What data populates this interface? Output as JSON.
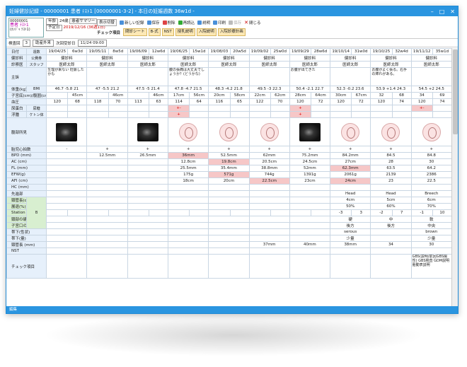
{
  "window": {
    "title": "妊婦健診記録 - 00000001 患者 ﾃｽﾄ1 [00000001-3-2] - 本日の妊娠週数 36w1d -",
    "controls": [
      "–",
      "□",
      "✕"
    ]
  },
  "patient": {
    "id": "00000001",
    "name": "患者 ﾃｽﾄ1",
    "kana": "(ｶﾝｼﾞｬ ﾃｽﾄ1)",
    "age_label": "年齢",
    "age": "24歳",
    "summary_button": "患者サマリー",
    "due_label": "予定日",
    "due_date": "2019/12/16 (36週1日)"
  },
  "toolbar": {
    "row1": [
      {
        "label": "表示切替"
      },
      {
        "label": "新しい記録"
      },
      {
        "label": "保存"
      },
      {
        "label": "削除"
      },
      {
        "label": "再読込"
      },
      {
        "label": "説明"
      },
      {
        "label": "印刷"
      },
      {
        "label": "保存"
      },
      {
        "label": "閉じる"
      }
    ],
    "row2_title": "チェック項目",
    "row2": [
      "問診シート",
      "B-式",
      "NST",
      "授乳説明",
      "入院説明",
      "入院診療計画"
    ]
  },
  "filter": {
    "exam_count_label": "検査回",
    "exam_count": "3",
    "type": "助産外来",
    "next_label": "次回受診日",
    "next_date": "11/24 09:00"
  },
  "columns": [
    {
      "date": "19/04/25",
      "week": "6w3d"
    },
    {
      "date": "19/05/11",
      "week": "8w5d"
    },
    {
      "date": "19/06/09",
      "week": "12w6d"
    },
    {
      "date": "19/06/25",
      "week": "15w1d"
    },
    {
      "date": "19/08/03",
      "week": "20w5d"
    },
    {
      "date": "19/09/02",
      "week": "25w0d"
    },
    {
      "date": "19/09/29",
      "week": "28w6d"
    },
    {
      "date": "19/10/14",
      "week": "31w0d"
    },
    {
      "date": "19/10/25",
      "week": "32w4d"
    },
    {
      "date": "19/11/12",
      "week": "35w1d"
    }
  ],
  "labels": {
    "date": "日付",
    "week": "週数",
    "consent": "健診料",
    "insurance": "公費券",
    "doctor": "診察医",
    "staff": "スタッフ",
    "complaint": "主訴",
    "weight": "体重(kg)",
    "bmi": "BMI",
    "fundus": "子宮底(cm)/腹囲(cm)",
    "bp": "血圧",
    "urine_protein": "尿蛋白",
    "urine_sugar": "尿糖",
    "edema": "浮腫",
    "ketone": "ケトン体",
    "echo": "腹部所見",
    "fhb": "胎児心拍数",
    "bpd": "BPD (mm)",
    "ac": "AC (cm)",
    "fl": "FL (mm)",
    "efw": "EFW(g)",
    "afi": "AFI (cm)",
    "hc": "HC (mm)",
    "presentation": "先進部",
    "cervix_len": "頸管長(cm)",
    "effacement": "展退(%)",
    "station": "Station",
    "cervix_hard": "頸部の硬さ",
    "cervix_pos": "子宮口の位置",
    "bishop": "B",
    "discharge": "帯下(性状)",
    "discharge_amt": "帯下(量)",
    "cervical_len2": "頸管長 (mm)",
    "nst": "NST",
    "check": "チェック項目"
  },
  "rows": {
    "consent": [
      "健診料",
      "健診料",
      "健診料",
      "健診料",
      "健診料",
      "健診料",
      "健診料",
      "健診料",
      "健診料",
      "健診料"
    ],
    "doctor": [
      "医師太郎",
      "医師太郎",
      "医師太郎",
      "医師太郎",
      "医師太郎",
      "医師太郎",
      "医師太郎",
      "医師太郎",
      "医師太郎",
      "医師太郎"
    ],
    "complaint": [
      "生理が来ない 妊娠したかも",
      "",
      "",
      "腹の張痛は大丈夫でしょうか？(どうかな)",
      "",
      "",
      "お腹が出てきた",
      "",
      "お腹がよく張る。右手の痺れがある。",
      ""
    ],
    "weight": [
      [
        "46.7",
        "-5.8",
        "21"
      ],
      [
        "47",
        "-5.5",
        "21.2"
      ],
      [
        "47.5",
        "-5",
        "21.4"
      ],
      [
        "47.8",
        "-4.7",
        "21.5"
      ],
      [
        "48.3",
        "-4.2",
        "21.8"
      ],
      [
        "49.5",
        "-3",
        "22.3"
      ],
      [
        "50.4",
        "-2.1",
        "22.7"
      ],
      [
        "52.3",
        "-0.2",
        "23.6"
      ],
      [
        "53.9",
        "+1.4",
        "24.3"
      ],
      [
        "54.5",
        "+2",
        "24.5"
      ]
    ],
    "fundus": [
      [
        "",
        "45cm"
      ],
      [
        "",
        "46cm"
      ],
      [
        "",
        "46cm"
      ],
      [
        "17cm",
        "56cm"
      ],
      [
        "20cm",
        "58cm"
      ],
      [
        "22cm",
        "62cm"
      ],
      [
        "28cm",
        "64cm"
      ],
      [
        "30cm",
        "67cm"
      ],
      [
        "32",
        "68"
      ],
      [
        "34",
        "69"
      ]
    ],
    "bp": [
      [
        "120",
        "68"
      ],
      [
        "118",
        "70"
      ],
      [
        "113",
        "63"
      ],
      [
        "114",
        "64"
      ],
      [
        "116",
        "65"
      ],
      [
        "122",
        "70"
      ],
      [
        "120",
        "72"
      ],
      [
        "120",
        "72"
      ],
      [
        "120",
        "74"
      ],
      [
        "120",
        "74"
      ]
    ],
    "urine_protein": [
      "",
      "",
      "",
      "+-",
      "",
      "",
      "+",
      "",
      "",
      "+-"
    ],
    "edema": [
      "",
      "",
      "",
      "+",
      "",
      "",
      "+",
      "",
      "",
      ""
    ],
    "echo": [
      "us",
      "",
      "us",
      "fetal",
      "fetal",
      "fetal",
      "us",
      "fetal",
      "fetal",
      "fetal"
    ],
    "fhb": [
      "-",
      "+",
      "+",
      "+",
      "+",
      "+",
      "+",
      "+",
      "+",
      "+"
    ],
    "bpd": [
      "",
      "12.5mm",
      "26.5mm",
      "36mm",
      "52.5mm",
      "62mm",
      "75.2mm",
      "84.2mm",
      "84.5",
      "84.8"
    ],
    "ac": [
      "",
      "",
      "",
      "12.8cm",
      "19.8cm",
      "20.5cm",
      "24.5cm",
      "27cm",
      "28",
      "30"
    ],
    "fl": [
      "",
      "",
      "",
      "25.5mm",
      "35.4mm",
      "38.8mm",
      "52mm",
      "62.3mm",
      "63.5",
      "64.2"
    ],
    "efw": [
      "",
      "",
      "",
      "175g",
      "571g",
      "744g",
      "1391g",
      "2061g",
      "2139",
      "2386"
    ],
    "afi": [
      "",
      "",
      "",
      "18cm",
      "20cm",
      "22.5cm",
      "23cm",
      "24cm",
      "23",
      "22.5"
    ],
    "presentation": [
      "",
      "",
      "",
      "",
      "",
      "",
      "",
      "Head",
      "Head",
      "Breech"
    ],
    "cervix_len": [
      "",
      "",
      "",
      "",
      "",
      "",
      "",
      "4cm",
      "5cm",
      "6cm"
    ],
    "effacement": [
      "",
      "",
      "",
      "",
      "",
      "",
      "",
      "50%",
      "60%",
      "70%"
    ],
    "station": [
      "",
      "",
      "",
      "",
      "",
      "",
      "",
      "-3",
      "-2",
      "-1"
    ],
    "station_num": [
      "",
      "",
      "",
      "",
      "",
      "",
      "",
      "3",
      "7",
      "10"
    ],
    "cervix_hard": [
      "",
      "",
      "",
      "",
      "",
      "",
      "",
      "硬",
      "中",
      "軟"
    ],
    "cervix_pos": [
      "",
      "",
      "",
      "",
      "",
      "",
      "",
      "後方",
      "後方",
      "中央"
    ],
    "discharge": [
      "",
      "",
      "",
      "",
      "",
      "",
      "",
      "serous",
      "",
      "brown"
    ],
    "discharge_amt": [
      "",
      "",
      "",
      "",
      "",
      "",
      "",
      "少量",
      "",
      "少量"
    ],
    "cervical_len2": [
      "",
      "",
      "",
      "",
      "",
      "37mm",
      "40mm",
      "38mm",
      "34",
      "30"
    ],
    "check": [
      "",
      "",
      "",
      "",
      "",
      "",
      "",
      "",
      "",
      "GBS(説明/前回GBS陽性) GBS検査 GDM説明 胎動表説明"
    ]
  },
  "status": "編集"
}
